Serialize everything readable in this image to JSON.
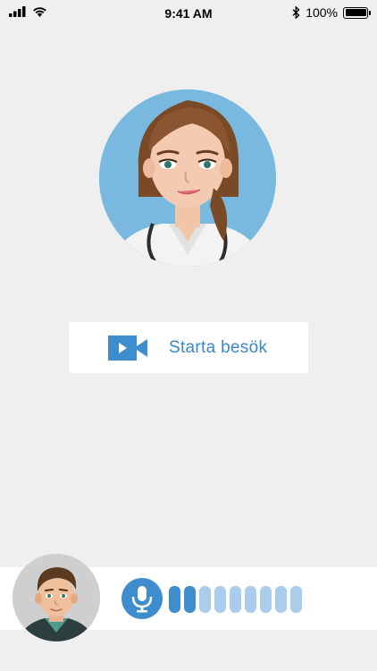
{
  "status_bar": {
    "time": "9:41 AM",
    "battery_percent_label": "100%",
    "battery_level": 1.0,
    "icons": [
      "signal-icon",
      "wifi-icon",
      "bluetooth-icon",
      "battery-icon"
    ]
  },
  "main": {
    "doctor_avatar": "doctor-avatar",
    "start_visit_label": "Starta besök",
    "start_visit_icon": "video-camera-icon"
  },
  "call_bar": {
    "patient_avatar": "patient-avatar",
    "mic_icon": "microphone-icon",
    "audio_level_bars_total": 9,
    "audio_level_bars_active": 2
  },
  "colors": {
    "accent": "#3e8dce",
    "accent_light": "#a9cdeb",
    "background": "#efefef",
    "doctor_bg": "#7ab9df"
  }
}
